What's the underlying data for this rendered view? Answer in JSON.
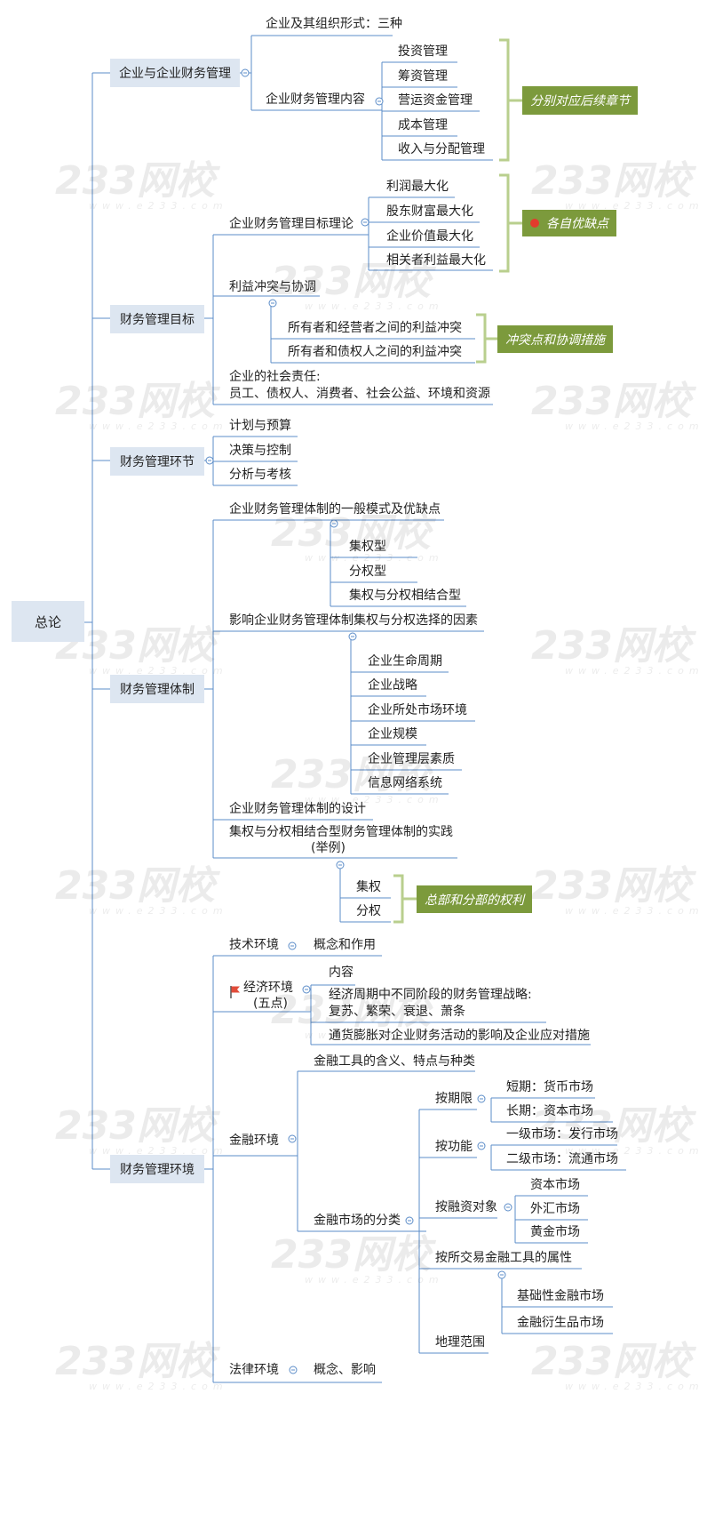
{
  "root": "总论",
  "sections": {
    "s1": {
      "label": "企业与企业财务管理",
      "c1": "企业及其组织形式：三种",
      "c2": "企业财务管理内容",
      "items": [
        "投资管理",
        "筹资管理",
        "营运资金管理",
        "成本管理",
        "收入与分配管理"
      ],
      "note": "分别对应后续章节"
    },
    "s2": {
      "label": "财务管理目标",
      "c1": "企业财务管理目标理论",
      "theories": [
        "利润最大化",
        "股东财富最大化",
        "企业价值最大化",
        "相关者利益最大化"
      ],
      "note_theory": "各自优缺点",
      "c2": "利益冲突与协调",
      "conflicts": [
        "所有者和经营者之间的利益冲突",
        "所有者和债权人之间的利益冲突"
      ],
      "note_conflict": "冲突点和协调措施",
      "c3_line1": "企业的社会责任:",
      "c3_line2": "员工、债权人、消费者、社会公益、环境和资源"
    },
    "s3": {
      "label": "财务管理环节",
      "items": [
        "计划与预算",
        "决策与控制",
        "分析与考核"
      ]
    },
    "s4": {
      "label": "财务管理体制",
      "c1": "企业财务管理体制的一般模式及优缺点",
      "modes": [
        "集权型",
        "分权型",
        "集权与分权相结合型"
      ],
      "c2": "影响企业财务管理体制集权与分权选择的因素",
      "factors": [
        "企业生命周期",
        "企业战略",
        "企业所处市场环境",
        "企业规模",
        "企业管理层素质",
        "信息网络系统"
      ],
      "c3": "企业财务管理体制的设计",
      "c4_line1": "集权与分权相结合型财务管理体制的实践",
      "c4_line2": "(举例)",
      "practice": [
        "集权",
        "分权"
      ],
      "note": "总部和分部的权利"
    },
    "s5": {
      "label": "财务管理环境",
      "tech": "技术环境",
      "tech_sub": "概念和作用",
      "econ_line1": "经济环境",
      "econ_line2": "(五点)",
      "econ_items": [
        "内容"
      ],
      "econ_cycle_line1": "经济周期中不同阶段的财务管理战略:",
      "econ_cycle_line2": "复苏、繁荣、衰退、萧条",
      "econ_inflation": "通货膨胀对企业财务活动的影响及企业应对措施",
      "fin": "金融环境",
      "fin_tools": "金融工具的含义、特点与种类",
      "fin_market": "金融市场的分类",
      "by_term": "按期限",
      "term_items": [
        "短期：货币市场",
        "长期：资本市场"
      ],
      "by_function": "按功能",
      "function_items": [
        "一级市场：发行市场",
        "二级市场：流通市场"
      ],
      "by_object": "按融资对象",
      "object_items": [
        "资本市场",
        "外汇市场",
        "黄金市场"
      ],
      "by_attr": "按所交易金融工具的属性",
      "attr_items": [
        "基础性金融市场",
        "金融衍生品市场"
      ],
      "by_geo": "地理范围",
      "law": "法律环境",
      "law_sub": "概念、影响"
    }
  },
  "watermark": "233网校",
  "watermark_url": "www.e233.com",
  "colors": {
    "box_fill": "#dde6f1",
    "line": "#5b8cc8",
    "note_fill": "#7c9a3c",
    "bracket": "#b9cf8e",
    "flag": "#e24c3a"
  }
}
